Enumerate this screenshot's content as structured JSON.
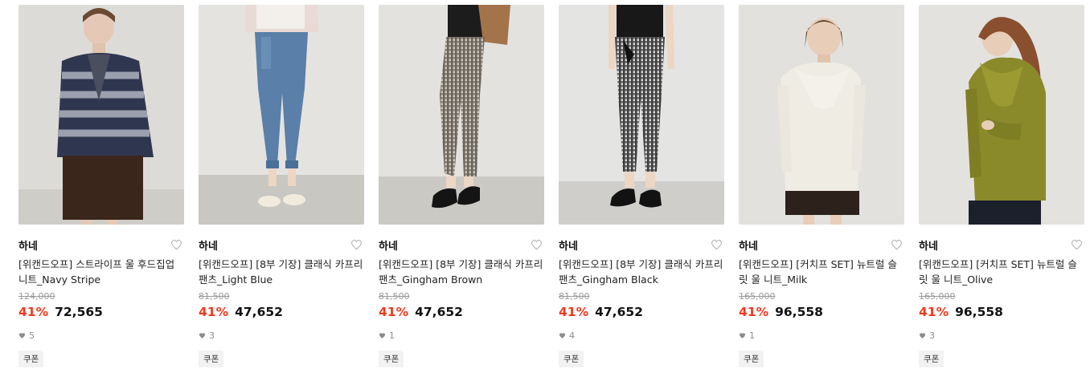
{
  "products": [
    {
      "brand": "하네",
      "name": "[위캔드오프] 스트라이프 울 후드집업 니트_Navy Stripe",
      "original_price": "124,000",
      "discount": "41%",
      "price": "72,565",
      "likes": "5",
      "tag": "쿠폰"
    },
    {
      "brand": "하네",
      "name": "[위캔드오프] [8부 기장] 클래식 카프리 팬츠_Light Blue",
      "original_price": "81,500",
      "discount": "41%",
      "price": "47,652",
      "likes": "3",
      "tag": "쿠폰"
    },
    {
      "brand": "하네",
      "name": "[위캔드오프] [8부 기장] 클래식 카프리 팬츠_Gingham Brown",
      "original_price": "81,500",
      "discount": "41%",
      "price": "47,652",
      "likes": "1",
      "tag": "쿠폰"
    },
    {
      "brand": "하네",
      "name": "[위캔드오프] [8부 기장] 클래식 카프리 팬츠_Gingham Black",
      "original_price": "81,500",
      "discount": "41%",
      "price": "47,652",
      "likes": "4",
      "tag": "쿠폰"
    },
    {
      "brand": "하네",
      "name": "[위캔드오프] [커치프 SET] 뉴트럴 슬릿 울 니트_Milk",
      "original_price": "165,000",
      "discount": "41%",
      "price": "96,558",
      "likes": "1",
      "tag": "쿠폰"
    },
    {
      "brand": "하네",
      "name": "[위캔드오프] [커치프 SET] 뉴트럴 슬릿 울 니트_Olive",
      "original_price": "165,000",
      "discount": "41%",
      "price": "96,558",
      "likes": "3",
      "tag": "쿠폰"
    }
  ],
  "colors": {
    "discount": "#ee3a1e",
    "heart_outline": "#b5b5b5",
    "likes_heart": "#8c8c8c",
    "coupon_bg": "#f2f2f2"
  },
  "icons": {
    "wishlist": "heart-outline-icon",
    "likes": "heart-filled-icon"
  }
}
